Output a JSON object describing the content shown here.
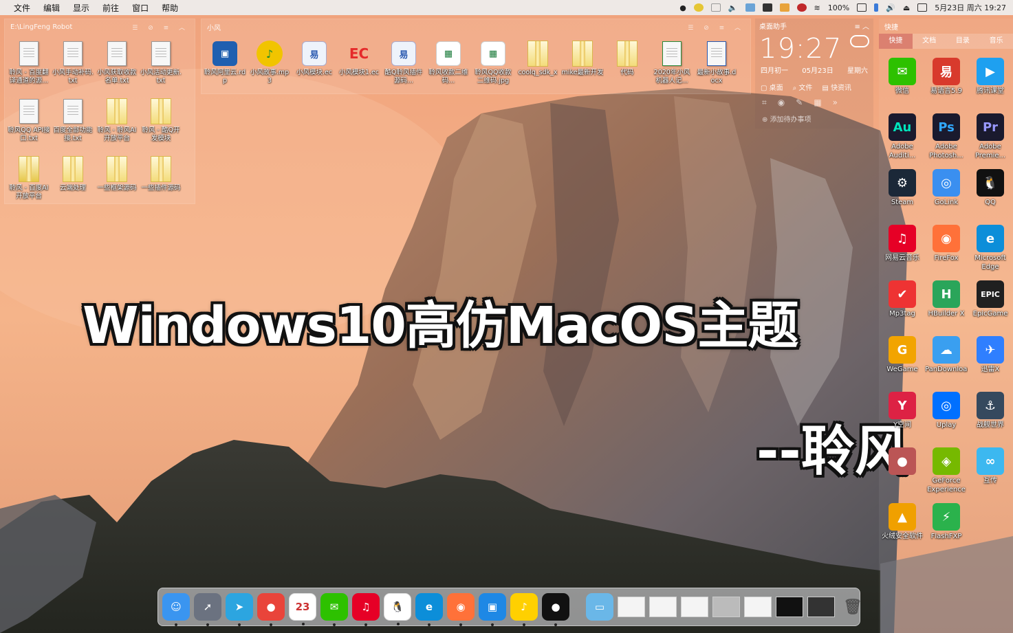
{
  "menubar": {
    "menus": [
      "文件",
      "编辑",
      "显示",
      "前往",
      "窗口",
      "帮助"
    ],
    "status": {
      "battery": "100%",
      "date": "5月23日 周六 19:27"
    }
  },
  "fence_left": {
    "title": "E:\\LingFeng Robot",
    "items": [
      {
        "label": "聆风 - 百度翻译通道的源...",
        "icon": "text-file-icon"
      },
      {
        "label": "小风手动补码.txt",
        "icon": "text-file-icon"
      },
      {
        "label": "小风获取收款名单.txt",
        "icon": "text-file-icon"
      },
      {
        "label": "小风活动更新.txt",
        "icon": "text-file-icon"
      },
      {
        "label": "聆风QQ API接口.txt",
        "icon": "text-file-icon"
      },
      {
        "label": "百度全部功能接.txt",
        "icon": "text-file-icon"
      },
      {
        "label": "聆风 - 聆风AI开放平台",
        "icon": "folder-icon"
      },
      {
        "label": "聆风 - 酷Q开发模块",
        "icon": "folder-icon"
      },
      {
        "label": "聆风 - 百度AI开放平台",
        "icon": "ai-icon"
      },
      {
        "label": "云端处理",
        "icon": "folder-icon"
      },
      {
        "label": "一些框架源码",
        "icon": "folder-icon"
      },
      {
        "label": "一些插件源码",
        "icon": "folder-icon"
      }
    ]
  },
  "fence_top": {
    "title": "小风",
    "items": [
      {
        "label": "聆风阿里云.rdp",
        "icon": "remote-desktop-icon"
      },
      {
        "label": "小风故事.mp3",
        "icon": "music-file-icon"
      },
      {
        "label": "小风模块.ec",
        "icon": "yi-module-icon"
      },
      {
        "label": "小风模块1.ec",
        "icon": "ec-icon"
      },
      {
        "label": "酷Q聆风插件源码...",
        "icon": "yi-module-icon"
      },
      {
        "label": "聆风收款二维码...",
        "icon": "qr-image-icon"
      },
      {
        "label": "聆风QQ收款二维码.jpg",
        "icon": "qr-image-icon"
      },
      {
        "label": "coolq_sdk_x",
        "icon": "folder-icon"
      },
      {
        "label": "mike最新开发",
        "icon": "folder-icon"
      },
      {
        "label": "代码",
        "icon": "folder-icon"
      },
      {
        "label": "2020年小风机器人记...",
        "icon": "spreadsheet-icon"
      },
      {
        "label": "最新小故事.docx",
        "icon": "word-doc-icon"
      }
    ]
  },
  "widget": {
    "title": "桌面助手",
    "time": "19:27",
    "lunar": "四月初一",
    "date": "05月23日",
    "weekday": "星期六",
    "buttons": [
      "桌面",
      "文件",
      "快资讯"
    ],
    "add_todo": "添加待办事项"
  },
  "panel": {
    "title": "快捷",
    "tabs": [
      "快捷",
      "文档",
      "目录",
      "音乐"
    ],
    "apps": [
      {
        "label": "微信",
        "icon": "wechat-icon",
        "color": "#2dc100"
      },
      {
        "label": "易语言5.9",
        "icon": "yi-language-icon",
        "color": "#d83a2c"
      },
      {
        "label": "腾讯课堂",
        "icon": "tencent-classroom-icon",
        "color": "#1ea0f0"
      },
      {
        "label": "Adobe Auditi...",
        "icon": "audition-icon",
        "color": "#00e4bb"
      },
      {
        "label": "Adobe Photosh...",
        "icon": "photoshop-icon",
        "color": "#31a8ff"
      },
      {
        "label": "Adobe Premie...",
        "icon": "premiere-icon",
        "color": "#9999ff"
      },
      {
        "label": "Steam",
        "icon": "steam-icon",
        "color": "#1b2838"
      },
      {
        "label": "GoLink",
        "icon": "golink-icon",
        "color": "#3a8ff0"
      },
      {
        "label": "QQ",
        "icon": "qq-icon",
        "color": "#111111"
      },
      {
        "label": "网易云音乐",
        "icon": "netease-music-icon",
        "color": "#e60026"
      },
      {
        "label": "FireFox",
        "icon": "firefox-icon",
        "color": "#ff7139"
      },
      {
        "label": "Microsoft Edge",
        "icon": "edge-icon",
        "color": "#0c8ed9"
      },
      {
        "label": "Mp3tag",
        "icon": "mp3tag-icon",
        "color": "#e33"
      },
      {
        "label": "HBuilder X",
        "icon": "hbuilder-icon",
        "color": "#2aa55a"
      },
      {
        "label": "EpicGame",
        "icon": "epic-games-icon",
        "color": "#202020"
      },
      {
        "label": "WeGame",
        "icon": "wegame-icon",
        "color": "#f2a400"
      },
      {
        "label": "PanDownload",
        "icon": "pandownload-icon",
        "color": "#3a9ff0"
      },
      {
        "label": "迅雷X",
        "icon": "thunder-icon",
        "color": "#2f7fff"
      },
      {
        "label": "Y空间",
        "icon": "yspace-icon",
        "color": "#d24"
      },
      {
        "label": "Uplay",
        "icon": "uplay-icon",
        "color": "#0070ff"
      },
      {
        "label": "战舰世界",
        "icon": "warships-icon",
        "color": "#35495e"
      },
      {
        "label": "",
        "icon": "unknown-app-icon",
        "color": "#b55"
      },
      {
        "label": "GeForce Experience",
        "icon": "geforce-icon",
        "color": "#76b900"
      },
      {
        "label": "互传",
        "icon": "hutran-icon",
        "color": "#3cb8f0"
      },
      {
        "label": "火绒安全软件",
        "icon": "huorong-icon",
        "color": "#f0a000"
      },
      {
        "label": "FlashFXP",
        "icon": "flashfxp-icon",
        "color": "#2bb24c"
      }
    ]
  },
  "overlay": {
    "headline": "Windows10高仿MacOS主题",
    "author": "--聆风"
  },
  "dock": {
    "apps": [
      {
        "name": "finder-icon",
        "color": "#3a95f0",
        "glyph": "☺"
      },
      {
        "name": "launchpad-icon",
        "color": "#6b7280",
        "glyph": "➚"
      },
      {
        "name": "telegram-icon",
        "color": "#2ca5e0",
        "glyph": "➤"
      },
      {
        "name": "chrome-icon",
        "color": "#e9443a",
        "glyph": "●"
      },
      {
        "name": "calendar-icon",
        "color": "#ffffff",
        "glyph": "23"
      },
      {
        "name": "wechat-icon",
        "color": "#2dc100",
        "glyph": "✉"
      },
      {
        "name": "netease-music-icon",
        "color": "#e60026",
        "glyph": "♫"
      },
      {
        "name": "qq-icon",
        "color": "#ffffff",
        "glyph": "🐧"
      },
      {
        "name": "edge-icon",
        "color": "#0c8ed9",
        "glyph": "e"
      },
      {
        "name": "firefox-icon",
        "color": "#ff7139",
        "glyph": "◉"
      },
      {
        "name": "files-icon",
        "color": "#1e88e5",
        "glyph": "▣"
      },
      {
        "name": "qq-music-icon",
        "color": "#ffd000",
        "glyph": "♪"
      },
      {
        "name": "recorder-icon",
        "color": "#111111",
        "glyph": "●"
      }
    ]
  }
}
